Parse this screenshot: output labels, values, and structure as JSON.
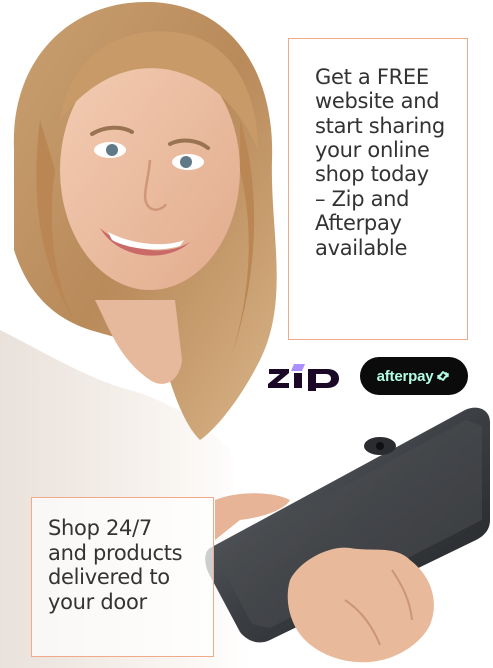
{
  "promo": {
    "headline_lines": [
      "Get a FREE",
      "website and",
      "start sharing",
      "your online",
      "shop today",
      "– Zip and",
      "Afterpay",
      "available"
    ]
  },
  "shop": {
    "lines": [
      "Shop 24/7",
      "and products",
      "delivered to",
      "your door"
    ]
  },
  "payments": {
    "zip_logo_icon": "zip-logo",
    "zip_text": "zip",
    "afterpay_label": "afterpay",
    "afterpay_icon": "afterpay-arrows-icon",
    "afterpay_badge_color": "#0b0b0b",
    "afterpay_text_color": "#b2fce4",
    "zip_text_color": "#1a0826",
    "zip_accent_color": "#aa8fff"
  },
  "colors": {
    "box_border": "#f2a98a",
    "body_text": "#333333"
  }
}
